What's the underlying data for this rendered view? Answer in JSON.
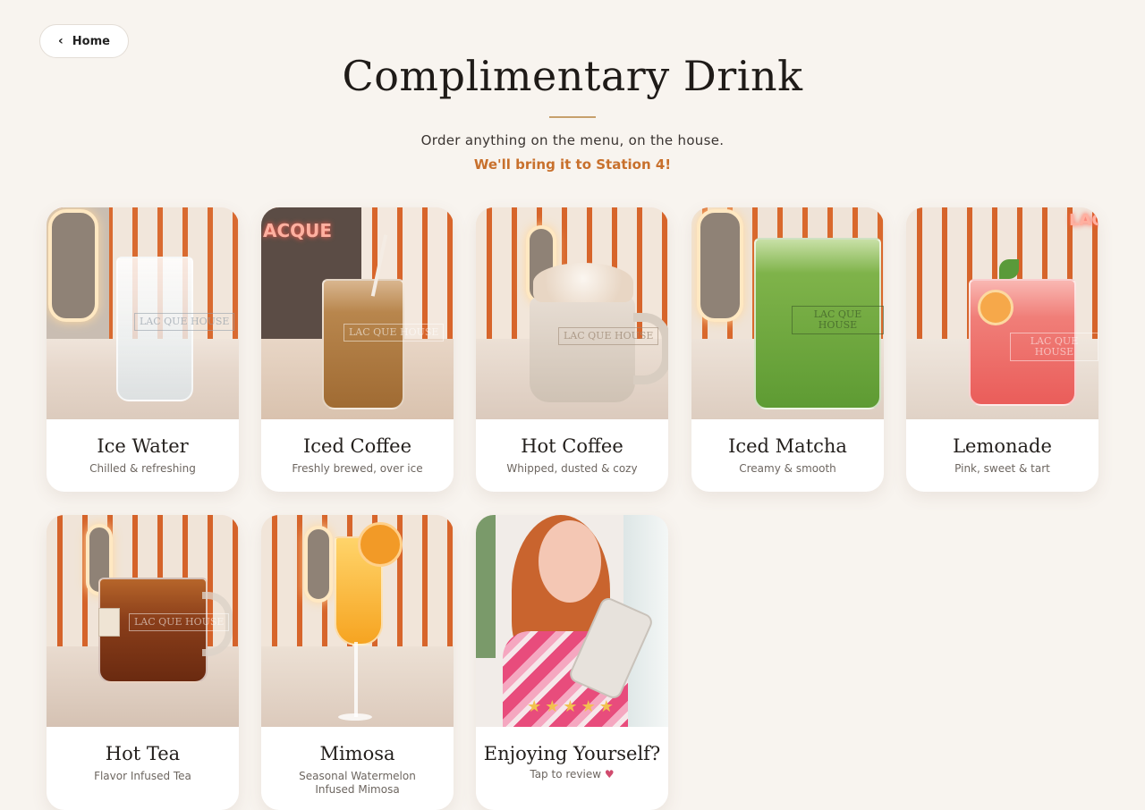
{
  "nav": {
    "home_label": "Home",
    "home_icon": "chevron-left-icon"
  },
  "header": {
    "title": "Complimentary Drink",
    "subtitle": "Order anything on the menu, on the house.",
    "station_note": "We'll bring it to Station 4!"
  },
  "colors": {
    "accent": "#c8702c",
    "rule": "#c7a06c",
    "background": "#f8f4ef",
    "star": "#f2c14e"
  },
  "menu": [
    {
      "name": "Ice Water",
      "description": "Chilled & refreshing"
    },
    {
      "name": "Iced Coffee",
      "description": "Freshly brewed, over ice"
    },
    {
      "name": "Hot Coffee",
      "description": "Whipped, dusted & cozy"
    },
    {
      "name": "Iced Matcha",
      "description": "Creamy & smooth"
    },
    {
      "name": "Lemonade",
      "description": "Pink, sweet & tart"
    },
    {
      "name": "Hot Tea",
      "description": "Flavor Infused Tea"
    },
    {
      "name": "Mimosa",
      "description": "Seasonal Watermelon Infused Mimosa"
    }
  ],
  "review_card": {
    "title": "Enjoying Yourself?",
    "cta": "Tap to review",
    "heart": "♥",
    "stars": "★★★★★"
  },
  "brand_marks": {
    "neon_sign": "ACQUE",
    "glass_logo": "LAC QUE HOUSE"
  }
}
